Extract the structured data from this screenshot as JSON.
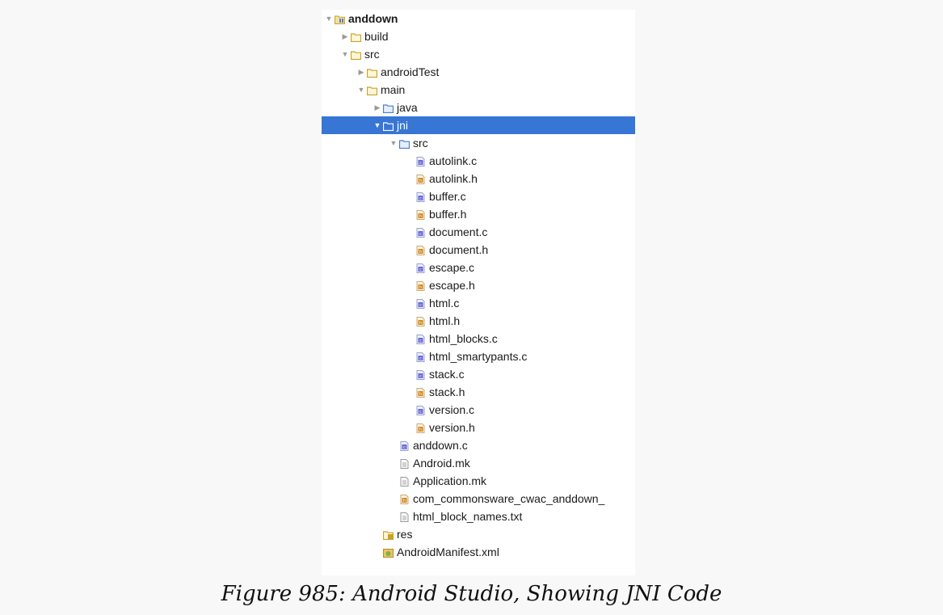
{
  "tree": {
    "rows": [
      {
        "label": "anddown",
        "icon": "module-folder-icon",
        "arrow": "expanded",
        "depth": 0,
        "bold": true
      },
      {
        "label": "build",
        "icon": "folder-icon",
        "arrow": "collapsed",
        "depth": 1
      },
      {
        "label": "src",
        "icon": "folder-icon",
        "arrow": "expanded",
        "depth": 1
      },
      {
        "label": "androidTest",
        "icon": "folder-icon",
        "arrow": "collapsed",
        "depth": 2
      },
      {
        "label": "main",
        "icon": "folder-icon",
        "arrow": "expanded",
        "depth": 2
      },
      {
        "label": "java",
        "icon": "source-folder-icon",
        "arrow": "collapsed",
        "depth": 3
      },
      {
        "label": "jni",
        "icon": "source-folder-icon",
        "arrow": "expanded",
        "depth": 3,
        "selected": true
      },
      {
        "label": "src",
        "icon": "source-folder-icon",
        "arrow": "expanded",
        "depth": 4
      },
      {
        "label": "autolink.c",
        "icon": "c-file-icon",
        "arrow": "none",
        "depth": 5
      },
      {
        "label": "autolink.h",
        "icon": "h-file-icon",
        "arrow": "none",
        "depth": 5
      },
      {
        "label": "buffer.c",
        "icon": "c-file-icon",
        "arrow": "none",
        "depth": 5
      },
      {
        "label": "buffer.h",
        "icon": "h-file-icon",
        "arrow": "none",
        "depth": 5
      },
      {
        "label": "document.c",
        "icon": "c-file-icon",
        "arrow": "none",
        "depth": 5
      },
      {
        "label": "document.h",
        "icon": "h-file-icon",
        "arrow": "none",
        "depth": 5
      },
      {
        "label": "escape.c",
        "icon": "c-file-icon",
        "arrow": "none",
        "depth": 5
      },
      {
        "label": "escape.h",
        "icon": "h-file-icon",
        "arrow": "none",
        "depth": 5
      },
      {
        "label": "html.c",
        "icon": "c-file-icon",
        "arrow": "none",
        "depth": 5
      },
      {
        "label": "html.h",
        "icon": "h-file-icon",
        "arrow": "none",
        "depth": 5
      },
      {
        "label": "html_blocks.c",
        "icon": "c-file-icon",
        "arrow": "none",
        "depth": 5
      },
      {
        "label": "html_smartypants.c",
        "icon": "c-file-icon",
        "arrow": "none",
        "depth": 5
      },
      {
        "label": "stack.c",
        "icon": "c-file-icon",
        "arrow": "none",
        "depth": 5
      },
      {
        "label": "stack.h",
        "icon": "h-file-icon",
        "arrow": "none",
        "depth": 5
      },
      {
        "label": "version.c",
        "icon": "c-file-icon",
        "arrow": "none",
        "depth": 5
      },
      {
        "label": "version.h",
        "icon": "h-file-icon",
        "arrow": "none",
        "depth": 5
      },
      {
        "label": "anddown.c",
        "icon": "c-file-icon",
        "arrow": "none",
        "depth": 4
      },
      {
        "label": "Android.mk",
        "icon": "text-file-icon",
        "arrow": "none",
        "depth": 4
      },
      {
        "label": "Application.mk",
        "icon": "text-file-icon",
        "arrow": "none",
        "depth": 4
      },
      {
        "label": "com_commonsware_cwac_anddown_",
        "icon": "h-file-icon",
        "arrow": "none",
        "depth": 4
      },
      {
        "label": "html_block_names.txt",
        "icon": "text-file-icon",
        "arrow": "none",
        "depth": 4
      },
      {
        "label": "res",
        "icon": "resource-folder-icon",
        "arrow": "none",
        "depth": 3
      },
      {
        "label": "AndroidManifest.xml",
        "icon": "manifest-file-icon",
        "arrow": "none",
        "depth": 3
      }
    ]
  },
  "caption": "Figure 985: Android Studio, Showing JNI Code",
  "colors": {
    "selection": "#3876d6",
    "folder": "#c9a227",
    "source_folder": "#4a7bd0",
    "c_file": "#6a6ad6",
    "h_file": "#d38a1c"
  }
}
